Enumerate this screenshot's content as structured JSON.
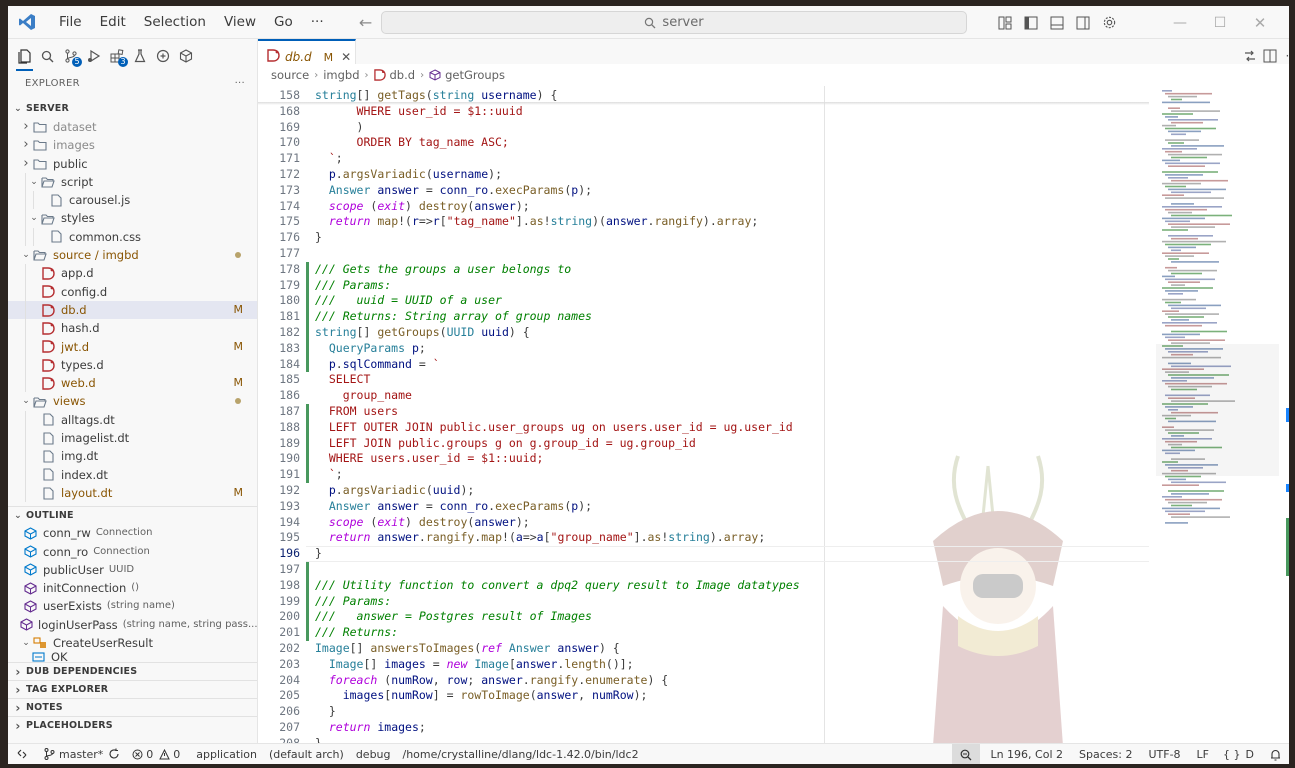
{
  "titlebar": {
    "menus": [
      "File",
      "Edit",
      "Selection",
      "View",
      "Go",
      "···"
    ],
    "search_text": "server"
  },
  "activity_badges": {
    "scm": "5",
    "run": "3"
  },
  "sidebar": {
    "title": "EXPLORER",
    "more": "···",
    "root_label": "SERVER",
    "tree": [
      {
        "label": "dataset",
        "depth": 1,
        "kind": "folder-closed",
        "dim": true
      },
      {
        "label": "images",
        "depth": 1,
        "kind": "folder-closed",
        "dim": true
      },
      {
        "label": "public",
        "depth": 1,
        "kind": "folder-closed"
      },
      {
        "label": "script",
        "depth": 2,
        "kind": "folder-open"
      },
      {
        "label": "carousel.js",
        "depth": 3,
        "kind": "file-js"
      },
      {
        "label": "styles",
        "depth": 2,
        "kind": "folder-open"
      },
      {
        "label": "common.css",
        "depth": 3,
        "kind": "file-css"
      },
      {
        "label": "source / imgbd",
        "depth": 1,
        "kind": "folder-open",
        "modified": true,
        "dot": true
      },
      {
        "label": "app.d",
        "depth": 2,
        "kind": "file-d"
      },
      {
        "label": "config.d",
        "depth": 2,
        "kind": "file-d"
      },
      {
        "label": "db.d",
        "depth": 2,
        "kind": "file-d",
        "modified": true,
        "mark": "M",
        "selected": true
      },
      {
        "label": "hash.d",
        "depth": 2,
        "kind": "file-d"
      },
      {
        "label": "jwt.d",
        "depth": 2,
        "kind": "file-d",
        "modified": true,
        "mark": "M"
      },
      {
        "label": "types.d",
        "depth": 2,
        "kind": "file-d"
      },
      {
        "label": "web.d",
        "depth": 2,
        "kind": "file-d",
        "modified": true,
        "mark": "M"
      },
      {
        "label": "views",
        "depth": 1,
        "kind": "folder-open",
        "modified": true,
        "dot": true
      },
      {
        "label": "alltags.dt",
        "depth": 2,
        "kind": "file-dt"
      },
      {
        "label": "imagelist.dt",
        "depth": 2,
        "kind": "file-dt"
      },
      {
        "label": "img.dt",
        "depth": 2,
        "kind": "file-dt"
      },
      {
        "label": "index.dt",
        "depth": 2,
        "kind": "file-dt"
      },
      {
        "label": "layout.dt",
        "depth": 2,
        "kind": "file-dt",
        "modified": true,
        "mark": "M"
      }
    ],
    "outline_label": "OUTLINE",
    "outline": [
      {
        "label": "conn_rw",
        "detail": "Connection",
        "kind": "field"
      },
      {
        "label": "conn_ro",
        "detail": "Connection",
        "kind": "field"
      },
      {
        "label": "publicUser",
        "detail": "UUID",
        "kind": "field"
      },
      {
        "label": "initConnection",
        "detail": "()",
        "kind": "method"
      },
      {
        "label": "userExists",
        "detail": "(string name)",
        "kind": "method"
      },
      {
        "label": "loginUserPass",
        "detail": "(string name, string pass...",
        "kind": "method"
      },
      {
        "label": "CreateUserResult",
        "detail": "",
        "kind": "enum"
      },
      {
        "label": "OK",
        "detail": "",
        "kind": "member"
      }
    ],
    "sections": [
      "DUB DEPENDENCIES",
      "TAG EXPLORER",
      "NOTES",
      "PLACEHOLDERS"
    ]
  },
  "tab": {
    "label": "db.d",
    "mark": "M"
  },
  "breadcrumb": [
    "source",
    "imgbd",
    "db.d",
    "getGroups"
  ],
  "code_lines": [
    {
      "n": "158",
      "sticky": true,
      "parts": [
        [
          "ty",
          "string"
        ],
        [
          "op",
          "[] "
        ],
        [
          "fn",
          "getTags"
        ],
        [
          "op",
          "("
        ],
        [
          "ty",
          "string"
        ],
        [
          "op",
          " "
        ],
        [
          "var",
          "username"
        ],
        [
          "op",
          ") {"
        ]
      ]
    },
    {
      "n": "169",
      "parts": [
        [
          "op",
          "      )"
        ]
      ]
    },
    {
      "n": "170",
      "parts": [
        [
          "str",
          "      ORDER BY tag_name ASC;"
        ]
      ]
    },
    {
      "n": "171",
      "parts": [
        [
          "str",
          "  `"
        ],
        [
          "op",
          ";"
        ]
      ]
    },
    {
      "n": "172",
      "parts": [
        [
          "op",
          "  "
        ],
        [
          "var",
          "p"
        ],
        [
          "op",
          "."
        ],
        [
          "fn",
          "argsVariadic"
        ],
        [
          "op",
          "("
        ],
        [
          "var",
          "username"
        ],
        [
          "op",
          ");"
        ]
      ]
    },
    {
      "n": "173",
      "parts": [
        [
          "op",
          "  "
        ],
        [
          "ty",
          "Answer"
        ],
        [
          "op",
          " "
        ],
        [
          "var",
          "answer"
        ],
        [
          "op",
          " = "
        ],
        [
          "var",
          "conn_ro"
        ],
        [
          "op",
          "."
        ],
        [
          "fn",
          "execParams"
        ],
        [
          "op",
          "("
        ],
        [
          "var",
          "p"
        ],
        [
          "op",
          ");"
        ]
      ]
    },
    {
      "n": "174",
      "parts": [
        [
          "op",
          "  "
        ],
        [
          "kc",
          "scope"
        ],
        [
          "op",
          " ("
        ],
        [
          "kc",
          "exit"
        ],
        [
          "op",
          ") "
        ],
        [
          "fn",
          "destroy"
        ],
        [
          "op",
          "("
        ],
        [
          "var",
          "answer"
        ],
        [
          "op",
          ");"
        ]
      ]
    },
    {
      "n": "175",
      "parts": [
        [
          "op",
          "  "
        ],
        [
          "kc",
          "return"
        ],
        [
          "op",
          " "
        ],
        [
          "fn",
          "map"
        ],
        [
          "op",
          "!("
        ],
        [
          "var",
          "r"
        ],
        [
          "op",
          "=>"
        ],
        [
          "var",
          "r"
        ],
        [
          "op",
          "["
        ],
        [
          "str",
          "\"tag_name\""
        ],
        [
          "op",
          "]."
        ],
        [
          "fn",
          "as"
        ],
        [
          "op",
          "!"
        ],
        [
          "ty",
          "string"
        ],
        [
          "op",
          ")("
        ],
        [
          "var",
          "answer"
        ],
        [
          "op",
          "."
        ],
        [
          "fn",
          "rangify"
        ],
        [
          "op",
          ")."
        ],
        [
          "fn",
          "array"
        ],
        [
          "op",
          ";"
        ]
      ]
    },
    {
      "n": "176",
      "parts": [
        [
          "op",
          "}"
        ]
      ]
    },
    {
      "n": "177",
      "parts": []
    },
    {
      "n": "178",
      "parts": [
        [
          "cm",
          "/// Gets the groups a user belongs to"
        ]
      ]
    },
    {
      "n": "179",
      "parts": [
        [
          "cm",
          "/// Params:"
        ]
      ]
    },
    {
      "n": "180",
      "parts": [
        [
          "cm",
          "///   uuid = UUID of a user"
        ]
      ]
    },
    {
      "n": "181",
      "parts": [
        [
          "cm",
          "/// Returns: String array of group names"
        ]
      ]
    },
    {
      "n": "182",
      "parts": [
        [
          "ty",
          "string"
        ],
        [
          "op",
          "[] "
        ],
        [
          "fn",
          "getGroups"
        ],
        [
          "op",
          "("
        ],
        [
          "ty",
          "UUID"
        ],
        [
          "op",
          " "
        ],
        [
          "var",
          "uuid"
        ],
        [
          "op",
          ") {"
        ]
      ]
    },
    {
      "n": "183",
      "parts": [
        [
          "op",
          "  "
        ],
        [
          "ty",
          "QueryParams"
        ],
        [
          "op",
          " "
        ],
        [
          "var",
          "p"
        ],
        [
          "op",
          ";"
        ]
      ]
    },
    {
      "n": "184",
      "parts": [
        [
          "op",
          "  "
        ],
        [
          "var",
          "p"
        ],
        [
          "op",
          "."
        ],
        [
          "var",
          "sqlCommand"
        ],
        [
          "op",
          " = "
        ],
        [
          "str",
          "`"
        ]
      ]
    },
    {
      "n": "185",
      "parts": [
        [
          "str",
          "  SELECT"
        ]
      ]
    },
    {
      "n": "186",
      "parts": [
        [
          "str",
          "    group_name"
        ]
      ]
    },
    {
      "n": "187",
      "parts": [
        [
          "str",
          "  FROM users"
        ]
      ]
    },
    {
      "n": "188",
      "parts": [
        [
          "str",
          "  LEFT OUTER JOIN public.user_groups ug on users.user_id = ug.user_id"
        ]
      ]
    },
    {
      "n": "189",
      "parts": [
        [
          "str",
          "  LEFT JOIN public.groups g on g.group_id = ug.group_id"
        ]
      ]
    },
    {
      "n": "190",
      "parts": [
        [
          "str",
          "  WHERE users.user_id = $1::uuid;"
        ]
      ]
    },
    {
      "n": "191",
      "parts": [
        [
          "str",
          "  `"
        ],
        [
          "op",
          ";"
        ]
      ]
    },
    {
      "n": "192",
      "parts": [
        [
          "op",
          "  "
        ],
        [
          "var",
          "p"
        ],
        [
          "op",
          "."
        ],
        [
          "fn",
          "argsVariadic"
        ],
        [
          "op",
          "("
        ],
        [
          "var",
          "uuid"
        ],
        [
          "op",
          ");"
        ]
      ]
    },
    {
      "n": "193",
      "parts": [
        [
          "op",
          "  "
        ],
        [
          "ty",
          "Answer"
        ],
        [
          "op",
          " "
        ],
        [
          "var",
          "answer"
        ],
        [
          "op",
          " = "
        ],
        [
          "var",
          "conn_ro"
        ],
        [
          "op",
          "."
        ],
        [
          "fn",
          "execParams"
        ],
        [
          "op",
          "("
        ],
        [
          "var",
          "p"
        ],
        [
          "op",
          ");"
        ]
      ]
    },
    {
      "n": "194",
      "parts": [
        [
          "op",
          "  "
        ],
        [
          "kc",
          "scope"
        ],
        [
          "op",
          " ("
        ],
        [
          "kc",
          "exit"
        ],
        [
          "op",
          ") "
        ],
        [
          "fn",
          "destroy"
        ],
        [
          "op",
          "("
        ],
        [
          "var",
          "answer"
        ],
        [
          "op",
          ");"
        ]
      ]
    },
    {
      "n": "195",
      "parts": [
        [
          "op",
          "  "
        ],
        [
          "kc",
          "return"
        ],
        [
          "op",
          " "
        ],
        [
          "var",
          "answer"
        ],
        [
          "op",
          "."
        ],
        [
          "fn",
          "rangify"
        ],
        [
          "op",
          "."
        ],
        [
          "fn",
          "map"
        ],
        [
          "op",
          "!("
        ],
        [
          "var",
          "a"
        ],
        [
          "op",
          "=>"
        ],
        [
          "var",
          "a"
        ],
        [
          "op",
          "["
        ],
        [
          "str",
          "\"group_name\""
        ],
        [
          "op",
          "]."
        ],
        [
          "fn",
          "as"
        ],
        [
          "op",
          "!"
        ],
        [
          "ty",
          "string"
        ],
        [
          "op",
          ")."
        ],
        [
          "fn",
          "array"
        ],
        [
          "op",
          ";"
        ]
      ]
    },
    {
      "n": "196",
      "current": true,
      "parts": [
        [
          "op",
          "}"
        ]
      ]
    },
    {
      "n": "197",
      "parts": []
    },
    {
      "n": "198",
      "parts": [
        [
          "cm",
          "/// Utility function to convert a dpq2 query result to Image datatypes"
        ]
      ]
    },
    {
      "n": "199",
      "parts": [
        [
          "cm",
          "/// Params:"
        ]
      ]
    },
    {
      "n": "200",
      "parts": [
        [
          "cm",
          "///   answer = Postgres result of Images"
        ]
      ]
    },
    {
      "n": "201",
      "parts": [
        [
          "cm",
          "/// Returns:"
        ]
      ]
    },
    {
      "n": "202",
      "parts": [
        [
          "ty",
          "Image"
        ],
        [
          "op",
          "[] "
        ],
        [
          "fn",
          "answersToImages"
        ],
        [
          "op",
          "("
        ],
        [
          "kc",
          "ref"
        ],
        [
          "op",
          " "
        ],
        [
          "ty",
          "Answer"
        ],
        [
          "op",
          " "
        ],
        [
          "var",
          "answer"
        ],
        [
          "op",
          ") {"
        ]
      ]
    },
    {
      "n": "203",
      "parts": [
        [
          "op",
          "  "
        ],
        [
          "ty",
          "Image"
        ],
        [
          "op",
          "[] "
        ],
        [
          "var",
          "images"
        ],
        [
          "op",
          " = "
        ],
        [
          "kc",
          "new"
        ],
        [
          "op",
          " "
        ],
        [
          "ty",
          "Image"
        ],
        [
          "op",
          "["
        ],
        [
          "var",
          "answer"
        ],
        [
          "op",
          "."
        ],
        [
          "fn",
          "length"
        ],
        [
          "op",
          "()];"
        ]
      ]
    },
    {
      "n": "204",
      "parts": [
        [
          "op",
          "  "
        ],
        [
          "kc",
          "foreach"
        ],
        [
          "op",
          " ("
        ],
        [
          "var",
          "numRow"
        ],
        [
          "op",
          ", "
        ],
        [
          "var",
          "row"
        ],
        [
          "op",
          "; "
        ],
        [
          "var",
          "answer"
        ],
        [
          "op",
          "."
        ],
        [
          "fn",
          "rangify"
        ],
        [
          "op",
          "."
        ],
        [
          "fn",
          "enumerate"
        ],
        [
          "op",
          ") {"
        ]
      ]
    },
    {
      "n": "205",
      "parts": [
        [
          "op",
          "    "
        ],
        [
          "var",
          "images"
        ],
        [
          "op",
          "["
        ],
        [
          "var",
          "numRow"
        ],
        [
          "op",
          "] = "
        ],
        [
          "fn",
          "rowToImage"
        ],
        [
          "op",
          "("
        ],
        [
          "var",
          "answer"
        ],
        [
          "op",
          ", "
        ],
        [
          "var",
          "numRow"
        ],
        [
          "op",
          ");"
        ]
      ]
    },
    {
      "n": "206",
      "parts": [
        [
          "op",
          "  }"
        ]
      ]
    },
    {
      "n": "207",
      "parts": [
        [
          "op",
          "  "
        ],
        [
          "kc",
          "return"
        ],
        [
          "op",
          " "
        ],
        [
          "var",
          "images"
        ],
        [
          "op",
          ";"
        ]
      ]
    },
    {
      "n": "208",
      "parts": [
        [
          "op",
          "}"
        ]
      ]
    }
  ],
  "sticky_sub": {
    "n": "168",
    "text": "      WHERE user_id = $1::uuid"
  },
  "status": {
    "branch": "master*",
    "errors": "0",
    "warnings": "0",
    "config": "application",
    "arch": "(default arch)",
    "build": "debug",
    "compiler": "/home/crystalline/dlang/ldc-1.42.0/bin/ldc2",
    "position": "Ln 196, Col 2",
    "spaces": "Spaces: 2",
    "encoding": "UTF-8",
    "eol": "LF",
    "language": "D"
  },
  "colors": {
    "accent": "#005fb8",
    "git_added": "#48985d",
    "modified": "#895503"
  }
}
